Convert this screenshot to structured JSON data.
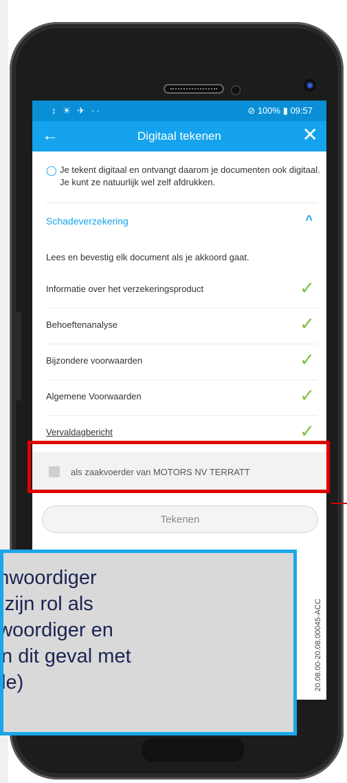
{
  "status": {
    "left_icons": "↕ ☀ ✈ ··",
    "right": "100% ▮ 09:57"
  },
  "appbar": {
    "back": "←",
    "title": "Digitaal tekenen",
    "close": "✕"
  },
  "info": {
    "icon": "◯",
    "text": "Je tekent digitaal en ontvangt daarom je documenten ook digitaal. Je kunt ze natuurlijk wel zelf afdrukken."
  },
  "section": {
    "title": "Schadeverzekering",
    "chevron": "^"
  },
  "instruction": "Lees en bevestig elk document als je akkoord gaat.",
  "documents": [
    {
      "label": "Informatie over het verzekeringsproduct",
      "check": "✓"
    },
    {
      "label": "Behoeftenanalyse",
      "check": "✓"
    },
    {
      "label": "Bijzondere voorwaarden",
      "check": "✓"
    },
    {
      "label": "Algemene Voorwaarden",
      "check": "✓"
    },
    {
      "label": "Vervaldagbericht",
      "check": "✓"
    }
  ],
  "confirm": {
    "label": "als zaakvoerder van MOTORS NV TERRATT"
  },
  "sign_button": "Tekenen",
  "version": "20.08.00-20.08.00045-ACC",
  "callout": "ertegenwoordiger\nvestigt zijn rol als\nrtegenwoordiger en\nkent. (in dit geval met\n pincode)",
  "colors": {
    "primary": "#14a3ec",
    "check": "#7ac142",
    "highlight": "#e00000",
    "callout_border": "#1aa6e8"
  }
}
